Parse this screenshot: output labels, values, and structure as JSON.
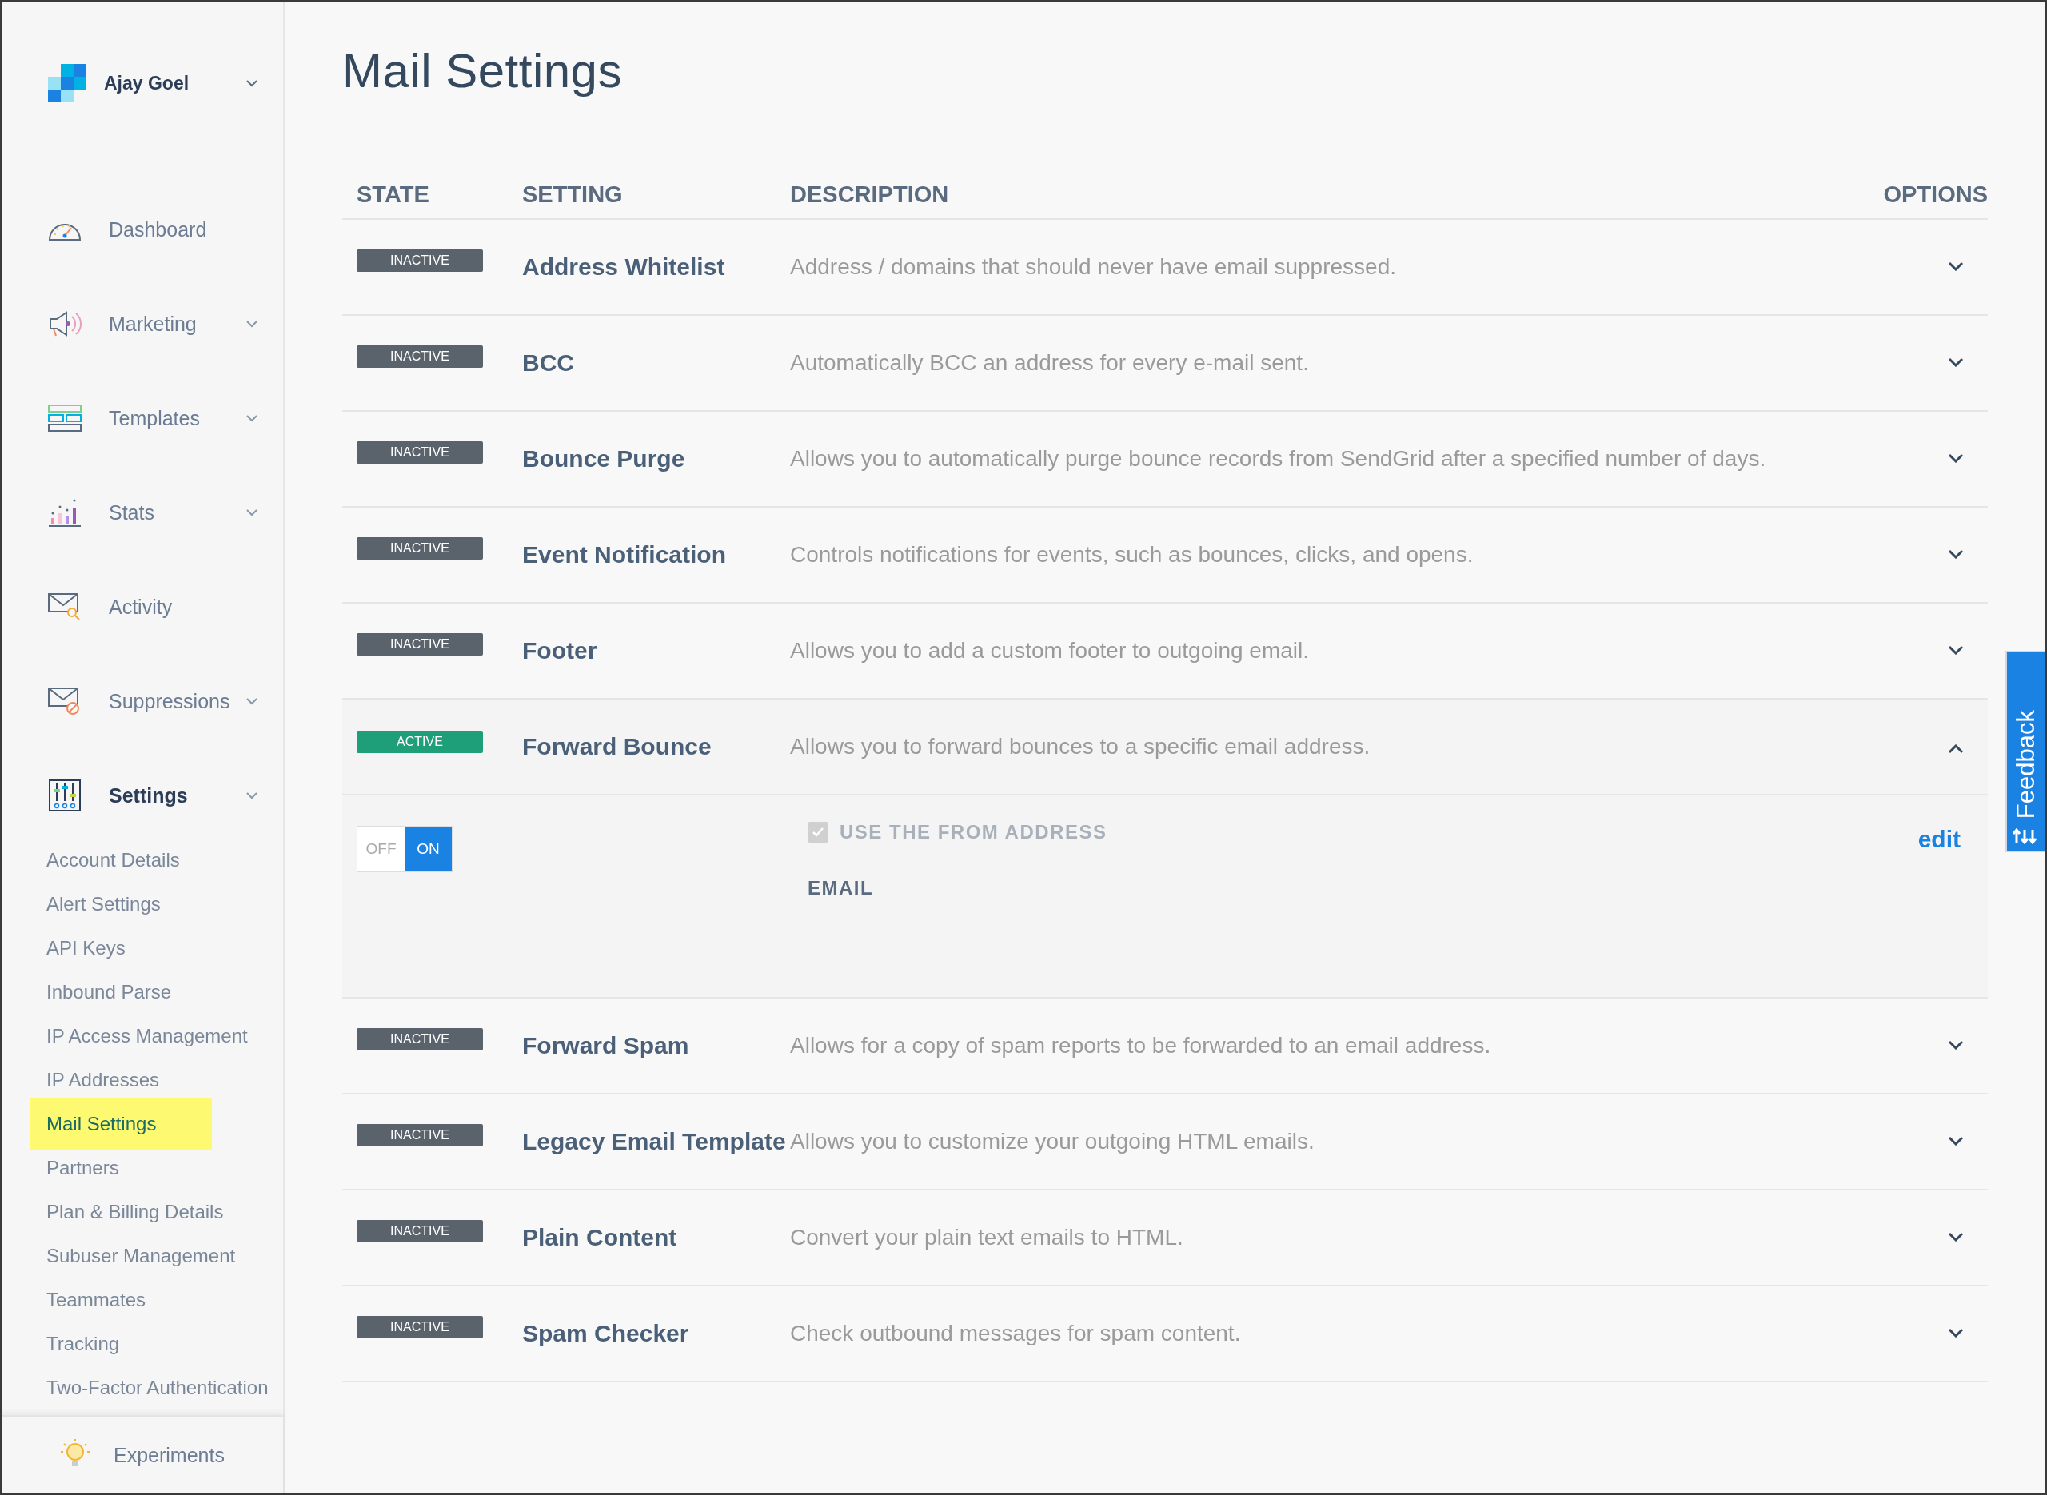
{
  "account": {
    "name": "Ajay Goel"
  },
  "nav": [
    {
      "label": "Dashboard",
      "expandable": false,
      "selected": false
    },
    {
      "label": "Marketing",
      "expandable": true,
      "selected": false
    },
    {
      "label": "Templates",
      "expandable": true,
      "selected": false
    },
    {
      "label": "Stats",
      "expandable": true,
      "selected": false
    },
    {
      "label": "Activity",
      "expandable": false,
      "selected": false
    },
    {
      "label": "Suppressions",
      "expandable": true,
      "selected": false
    },
    {
      "label": "Settings",
      "expandable": true,
      "selected": true,
      "children": [
        {
          "label": "Account Details",
          "selected": false
        },
        {
          "label": "Alert Settings",
          "selected": false
        },
        {
          "label": "API Keys",
          "selected": false
        },
        {
          "label": "Inbound Parse",
          "selected": false
        },
        {
          "label": "IP Access Management",
          "selected": false
        },
        {
          "label": "IP Addresses",
          "selected": false
        },
        {
          "label": "Mail Settings",
          "selected": true
        },
        {
          "label": "Partners",
          "selected": false
        },
        {
          "label": "Plan & Billing Details",
          "selected": false
        },
        {
          "label": "Subuser Management",
          "selected": false
        },
        {
          "label": "Teammates",
          "selected": false
        },
        {
          "label": "Tracking",
          "selected": false
        },
        {
          "label": "Two-Factor Authentication",
          "selected": false
        }
      ]
    }
  ],
  "footer": {
    "label": "Experiments"
  },
  "page": {
    "title": "Mail Settings"
  },
  "table": {
    "columns": [
      "STATE",
      "SETTING",
      "DESCRIPTION",
      "OPTIONS"
    ],
    "rows": [
      {
        "state": "INACTIVE",
        "active": false,
        "setting": "Address Whitelist",
        "description": "Address / domains that should never have email suppressed.",
        "expanded": false
      },
      {
        "state": "INACTIVE",
        "active": false,
        "setting": "BCC",
        "description": "Automatically BCC an address for every e-mail sent.",
        "expanded": false
      },
      {
        "state": "INACTIVE",
        "active": false,
        "setting": "Bounce Purge",
        "description": "Allows you to automatically purge bounce records from SendGrid after a specified number of days.",
        "expanded": false
      },
      {
        "state": "INACTIVE",
        "active": false,
        "setting": "Event Notification",
        "description": "Controls notifications for events, such as bounces, clicks, and opens.",
        "expanded": false
      },
      {
        "state": "INACTIVE",
        "active": false,
        "setting": "Footer",
        "description": "Allows you to add a custom footer to outgoing email.",
        "expanded": false
      },
      {
        "state": "ACTIVE",
        "active": true,
        "setting": "Forward Bounce",
        "description": "Allows you to forward bounces to a specific email address.",
        "expanded": true,
        "details": {
          "toggle": {
            "off_label": "OFF",
            "on_label": "ON",
            "on": true
          },
          "checkbox": {
            "label": "USE THE FROM ADDRESS",
            "checked": true,
            "disabled": true
          },
          "email_label": "EMAIL",
          "edit_link": "edit"
        }
      },
      {
        "state": "INACTIVE",
        "active": false,
        "setting": "Forward Spam",
        "description": "Allows for a copy of spam reports to be forwarded to an email address.",
        "expanded": false
      },
      {
        "state": "INACTIVE",
        "active": false,
        "setting": "Legacy Email Template",
        "description": "Allows you to customize your outgoing HTML emails.",
        "expanded": false
      },
      {
        "state": "INACTIVE",
        "active": false,
        "setting": "Plain Content",
        "description": "Convert your plain text emails to HTML.",
        "expanded": false
      },
      {
        "state": "INACTIVE",
        "active": false,
        "setting": "Spam Checker",
        "description": "Check outbound messages for spam content.",
        "expanded": false
      }
    ]
  },
  "feedback_tab": {
    "label": "Feedback"
  }
}
